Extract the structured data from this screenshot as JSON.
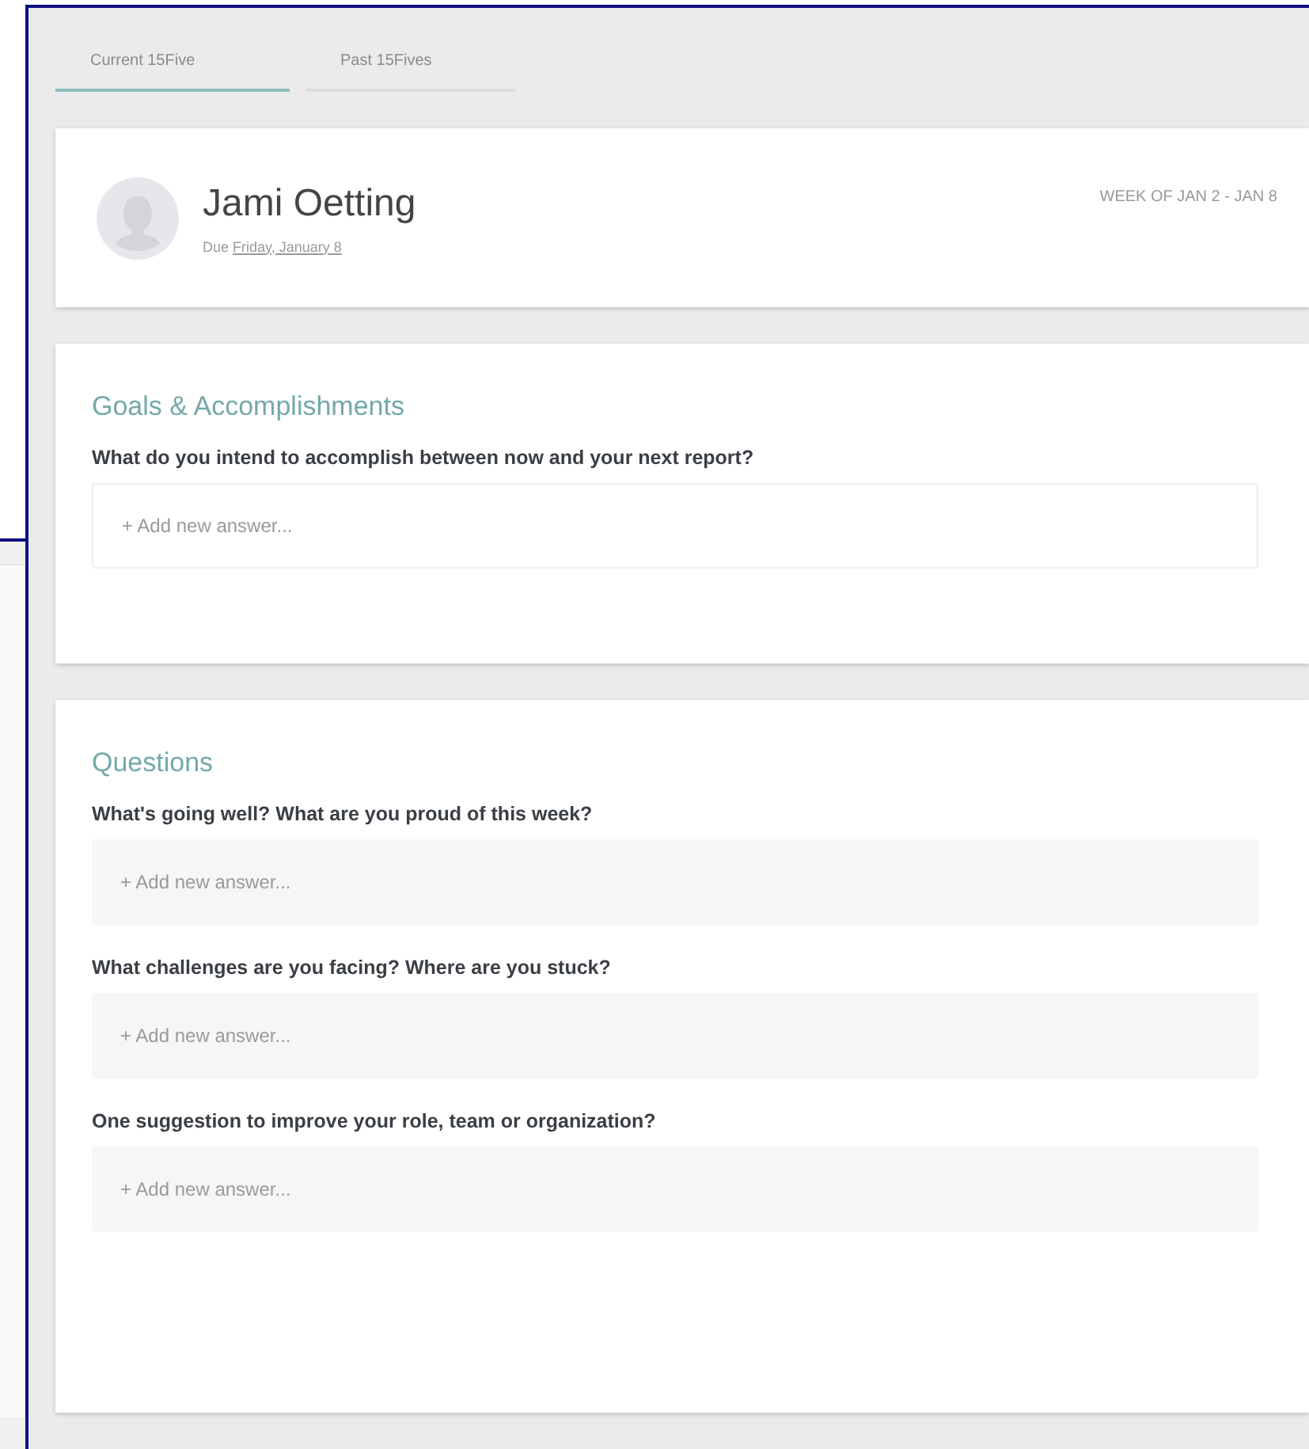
{
  "tabs": [
    {
      "label": "Current 15Five",
      "selected": true
    },
    {
      "label": "Past 15Fives",
      "selected": false
    }
  ],
  "header": {
    "name": "Jami Oetting",
    "due_label": "Due",
    "due_date": "Friday, January 8",
    "week": "WEEK OF JAN 2 - JAN 8"
  },
  "sections": [
    {
      "title": "Goals & Accomplishments",
      "questions": [
        {
          "text": "What do you intend to accomplish between now and your next report?",
          "placeholder": "+ Add new answer...",
          "kind": "outlined"
        }
      ]
    },
    {
      "title": "Questions",
      "questions": [
        {
          "text": "What's going well? What are you proud of this week?",
          "placeholder": "+ Add new answer...",
          "kind": "filled"
        },
        {
          "text": "What challenges are you facing? Where are you stuck?",
          "placeholder": "+ Add new answer...",
          "kind": "filled"
        },
        {
          "text": "One suggestion to improve your role, team or organization?",
          "placeholder": "+ Add new answer...",
          "kind": "filled"
        }
      ]
    }
  ]
}
